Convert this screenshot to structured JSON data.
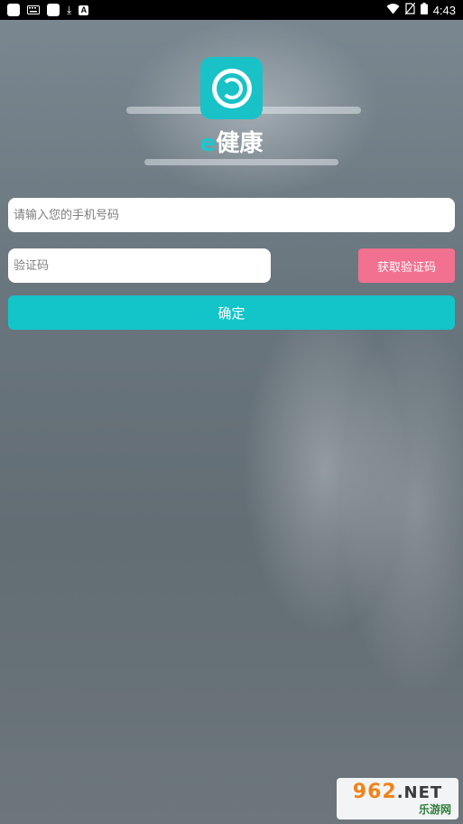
{
  "status_bar": {
    "time": "4:43",
    "left_icons": [
      "app-notification-icon",
      "keyboard-icon",
      "app-notification-icon",
      "download-icon",
      "a-badge-icon"
    ],
    "right_icons": [
      "wifi-icon",
      "no-sim-icon",
      "battery-icon"
    ],
    "a_badge": "A",
    "download_glyph": "⤓"
  },
  "app": {
    "brand_e": "e",
    "brand_name": "健康",
    "logo_icon": "ring-logo-icon",
    "accent_color": "#18c2c7",
    "button_pink": "#f27090"
  },
  "form": {
    "phone_placeholder": "请输入您的手机号码",
    "code_placeholder": "验证码",
    "get_code_label": "获取验证码",
    "confirm_label": "确定"
  },
  "watermark": {
    "main": "962",
    "net": ".NET",
    "sub": "乐游网"
  }
}
